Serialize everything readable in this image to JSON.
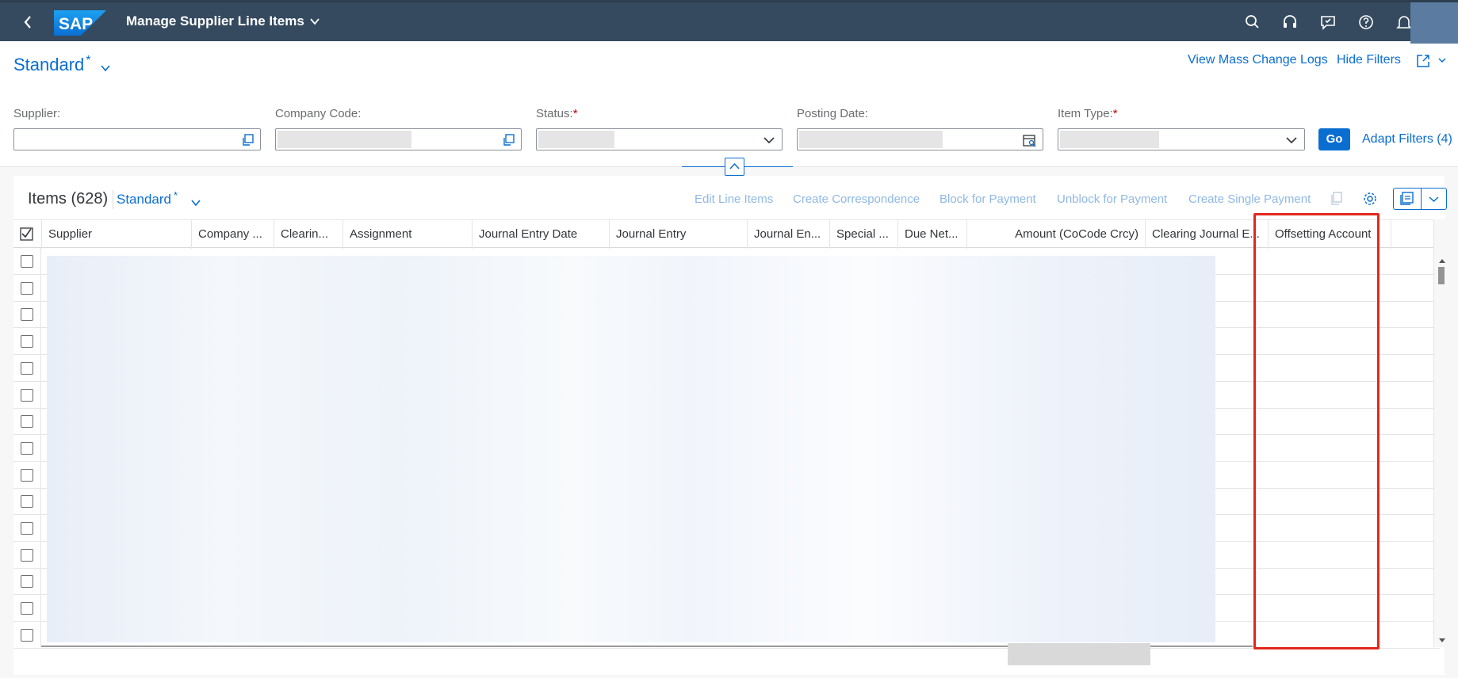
{
  "shell": {
    "logo_text": "SAP",
    "title": "Manage Supplier Line Items",
    "icons": [
      "search-icon",
      "headset-icon",
      "feedback-icon",
      "help-icon",
      "bell-icon"
    ]
  },
  "header": {
    "variant": "Standard",
    "variant_modified": "*",
    "links": {
      "mass_change": "View Mass Change Logs",
      "hide_filters": "Hide Filters"
    }
  },
  "filters": {
    "supplier": {
      "label": "Supplier:",
      "value": ""
    },
    "company_code": {
      "label": "Company Code:",
      "value": ""
    },
    "status": {
      "label": "Status:",
      "required": "*",
      "value": ""
    },
    "posting_date": {
      "label": "Posting Date:",
      "value": ""
    },
    "item_type": {
      "label": "Item Type:",
      "required": "*",
      "value": ""
    },
    "go": "Go",
    "adapt": "Adapt Filters (4)"
  },
  "table": {
    "title": "Items (628)",
    "variant": "Standard",
    "variant_modified": "*",
    "toolbar": {
      "edit": "Edit Line Items",
      "correspondence": "Create Correspondence",
      "block": "Block for Payment",
      "unblock": "Unblock for Payment",
      "single_payment": "Create Single Payment"
    },
    "columns": [
      "Supplier",
      "Company ...",
      "Clearin...",
      "Assignment",
      "Journal Entry Date",
      "Journal Entry",
      "Journal En...",
      "Special ...",
      "Due Net...",
      "Amount (CoCode Crcy)",
      "Clearing Journal E...",
      "Offsetting Account"
    ],
    "row_count_visible": 15
  },
  "colors": {
    "shell": "#354a5f",
    "accent": "#0a6ed1",
    "highlight": "#e0281e"
  }
}
